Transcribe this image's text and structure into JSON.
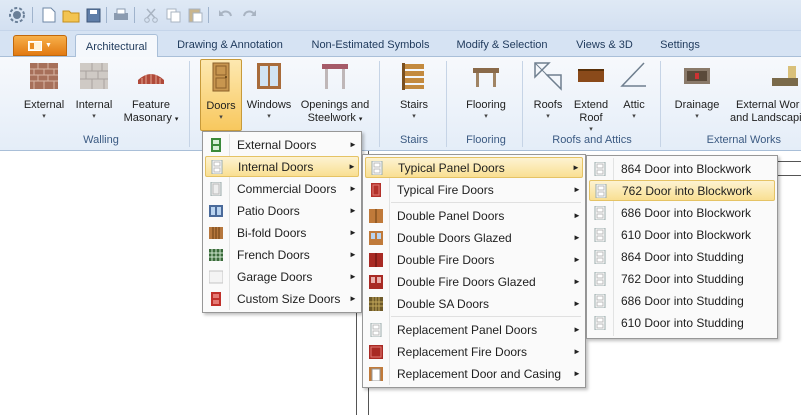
{
  "tabs": [
    {
      "label": "Architectural",
      "active": true
    },
    {
      "label": "Drawing & Annotation"
    },
    {
      "label": "Non-Estimated Symbols"
    },
    {
      "label": "Modify & Selection"
    },
    {
      "label": "Views & 3D"
    },
    {
      "label": "Settings"
    }
  ],
  "ribbon": {
    "external": "External",
    "internal": "Internal",
    "feature1": "Feature",
    "feature2": "Masonary",
    "doors": "Doors",
    "windows": "Windows",
    "openings1": "Openings and",
    "openings2": "Steelwork",
    "stairs": "Stairs",
    "flooring": "Flooring",
    "roofs": "Roofs",
    "extend1": "Extend",
    "extend2": "Roof",
    "attic": "Attic",
    "drainage": "Drainage",
    "extworks1": "External Wor",
    "extworks2": "and Landscapin",
    "groups": {
      "walling": "Walling",
      "stairs": "Stairs",
      "flooring": "Flooring",
      "roofs_attics": "Roofs and Attics",
      "external_works": "External Works"
    }
  },
  "menu1": [
    {
      "label": "External Doors"
    },
    {
      "label": "Internal Doors",
      "highlighted": true
    },
    {
      "label": "Commercial Doors"
    },
    {
      "label": "Patio Doors"
    },
    {
      "label": "Bi-fold Doors"
    },
    {
      "label": "French Doors"
    },
    {
      "label": "Garage Doors"
    },
    {
      "label": "Custom Size Doors"
    }
  ],
  "menu2": [
    {
      "label": "Typical Panel Doors",
      "highlighted": true
    },
    {
      "label": "Typical Fire Doors"
    },
    {
      "label": "Double Panel Doors"
    },
    {
      "label": "Double Doors Glazed"
    },
    {
      "label": "Double Fire Doors"
    },
    {
      "label": "Double Fire Doors Glazed"
    },
    {
      "label": "Double SA Doors"
    },
    {
      "label": "Replacement Panel Doors"
    },
    {
      "label": "Replacement Fire Doors"
    },
    {
      "label": "Replacement Door and Casing"
    }
  ],
  "menu3": [
    {
      "label": "864 Door into Blockwork"
    },
    {
      "label": "762 Door into Blockwork",
      "highlighted": true
    },
    {
      "label": "686 Door into Blockwork"
    },
    {
      "label": "610 Door into Blockwork"
    },
    {
      "label": "864 Door into Studding"
    },
    {
      "label": "762 Door into Studding"
    },
    {
      "label": "686 Door into Studding"
    },
    {
      "label": "610 Door into Studding"
    }
  ],
  "colors": {
    "accent_orange": "#e27a12",
    "highlight": "#f9df92",
    "ribbon_bg": "#e4edf8"
  }
}
